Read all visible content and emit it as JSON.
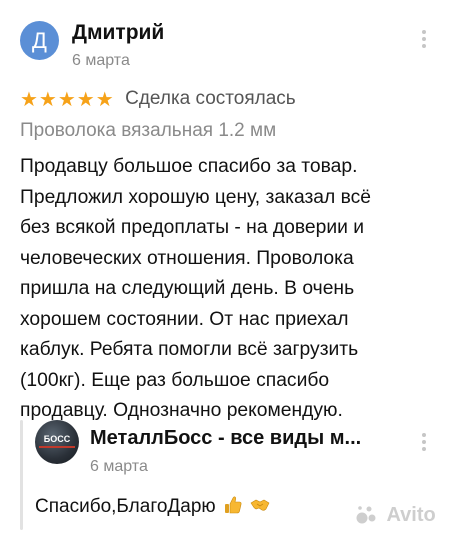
{
  "review": {
    "avatar_letter": "Д",
    "author": "Дмитрий",
    "date": "6 марта",
    "stars": "★★★★★",
    "deal_status": "Сделка состоялась",
    "product": "Проволока вязальная 1.2 мм",
    "text_lines": [
      "Продавцу большое спасибо за товар.",
      "Предложил хорошую цену, заказал всё",
      "без всякой предоплаты - на доверии и",
      "человеческих отношения. Проволока",
      "пришла на следующий день. В очень",
      "хорошем состоянии.  От нас приехал",
      "каблук. Ребята помогли всё загрузить",
      "(100кг). Еще раз большое спасибо",
      "продавцу. Однозначно рекомендую."
    ]
  },
  "reply": {
    "logo_text": "БОСС",
    "seller": "МеталлБосс - все виды м...",
    "date": "6 марта",
    "text": "Спасибо,БлагоДарю"
  },
  "watermark": {
    "text": "Avito"
  },
  "colors": {
    "star": "#f6a219",
    "avatar": "#5b8fd6",
    "muted": "#8a8a8a"
  },
  "icons": {
    "menu": "kebab-menu-icon",
    "reply_emoji": [
      "thumbs-up-icon",
      "handshake-icon"
    ],
    "watermark": "avito-logo-icon"
  }
}
